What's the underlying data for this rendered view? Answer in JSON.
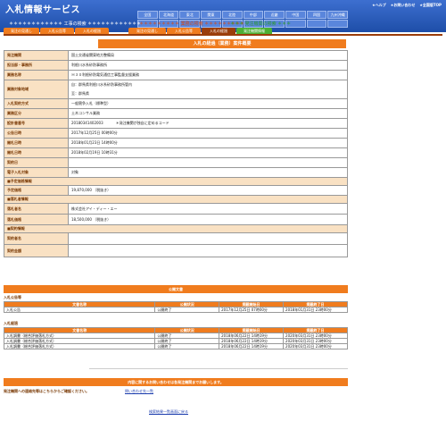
{
  "header": {
    "app_title": "入札情報サービス",
    "top_links": [
      "★ヘルプ",
      "★お問い合わせ",
      "★全国版TOP"
    ],
    "work_label": "＊＊＊＊＊＊＊＊＊＊＊＊ 工事の検索 ＊＊＊＊＊＊＊＊＊＊＊＊",
    "search_label": "＊＊＊＊＊＊＊＊＊ 業務の検索 ＊＊＊＊＊＊＊＊＊",
    "publish_label": "＊＊＊ 発注機関の検索 ＊＊＊",
    "regions": [
      "全国",
      "北海道",
      "東北",
      "関東",
      "北陸",
      "中部",
      "近畿",
      "中国",
      "四国",
      "九州沖縄"
    ],
    "regions2": [
      "",
      "",
      "",
      "",
      "",
      "",
      "",
      "",
      "",
      ""
    ]
  },
  "tabs": [
    {
      "label": "発注の見通し",
      "style": "normal"
    },
    {
      "label": "入札公告等",
      "style": "normal"
    },
    {
      "label": "入札の経過",
      "style": "normal"
    },
    {
      "label": "",
      "style": "spacer"
    },
    {
      "label": "発注の見通し",
      "style": "normal"
    },
    {
      "label": "入札公告等",
      "style": "normal"
    },
    {
      "label": "入札の経過",
      "style": "active"
    },
    {
      "label": "発注機関情報",
      "style": "green"
    }
  ],
  "main_title": "入札の経過（業務）案件概要",
  "detail": {
    "rows": [
      {
        "k": "発注機関",
        "v": "国土交通省関東地方整備局"
      },
      {
        "k": "担当部・事務所",
        "v": "利根川水系砂防事務所"
      },
      {
        "k": "業務名称",
        "v": "Ｈ３０利根砂防電気通信工事監督支援業務"
      },
      {
        "k": "業務対象地域",
        "v": "自：群馬県利根川水系砂防事務所管内",
        "v2": "至：群馬県"
      },
      {
        "k": "入札契約方式",
        "v": "一般競争入札（標準型）"
      },
      {
        "k": "業務区分",
        "v": "土木コンサル業務"
      },
      {
        "k": "設計書番号",
        "v": "20180341402003",
        "note": "＊発注機関が独自に定めるコード"
      },
      {
        "k": "公告日時",
        "v": "2017年12月25日 00時00分"
      },
      {
        "k": "開札日時",
        "v": "2018年01月23日 14時00分"
      },
      {
        "k": "開札日時",
        "v": "2018年02月19日 10時31分"
      },
      {
        "k": "契約日",
        "v": ""
      },
      {
        "k": "電子入札対象",
        "v": "対象"
      }
    ],
    "planned_section": "■予定価格情報",
    "planned_rows": [
      {
        "k": "予定価格",
        "v": "19,870,000 （税抜き）"
      }
    ],
    "winner_section": "■落札者情報",
    "winner_rows": [
      {
        "k": "落札者名",
        "v": "株式会社アイ・ディー・エー"
      },
      {
        "k": "落札価格",
        "v": "18,500,000 （税抜き）"
      }
    ],
    "contract_section": "■契約情報",
    "contract_rows": [
      {
        "k": "契約者名",
        "v": ""
      },
      {
        "k": "契約金額",
        "v": ""
      }
    ]
  },
  "docs": {
    "title": "公開文書",
    "group1_label": "入札公告等",
    "group2_label": "入札経過",
    "headers": [
      "文書名称",
      "公開状況",
      "掲載開始日",
      "掲載終了日"
    ],
    "group1_rows": [
      [
        "入札公告",
        "公開終了",
        "2017年12月25日 07時00分",
        "2018年01月31日 23時00分"
      ]
    ],
    "group2_rows": [
      [
        "入札調書（総合評価落札方式）",
        "公開終了",
        "2018年06月22日 14時19分",
        "2020年03月31日 23時00分"
      ],
      [
        "入札調書（総合評価落札方式）",
        "公開終了",
        "2018年06月22日 14時19分",
        "2020年03月31日 23時00分"
      ],
      [
        "入札調書（総合評価落札方式）",
        "公開終了",
        "2018年06月22日 14時19分",
        "2020年03月31日 23時00分"
      ]
    ]
  },
  "footer": {
    "inquiry_bar": "内容に関するお問い合わせは各発注機関までお願いします。",
    "inquiry_note": "発注機関への連絡先等はこちらからご確認ください。",
    "inquiry_link": "問い合わせ先一覧",
    "back_link": "検索結果一覧画面に戻る"
  },
  "colors": {
    "header_blue": "#1e4ea8",
    "accent_orange": "#f07c1e",
    "active_tab": "#9a3d0a",
    "key_cell_bg": "#f9e1c3",
    "green_tab": "#4caf35"
  }
}
